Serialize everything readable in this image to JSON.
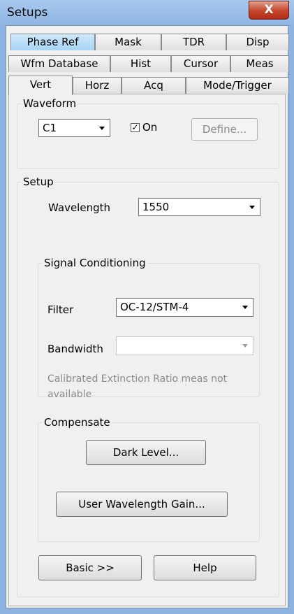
{
  "window": {
    "title": "Setups",
    "close_label": "X"
  },
  "tabs": {
    "row1": [
      "Phase Ref",
      "Mask",
      "TDR",
      "Disp"
    ],
    "row2": [
      "Wfm Database",
      "Hist",
      "Cursor",
      "Meas"
    ],
    "row3": [
      "Vert",
      "Horz",
      "Acq",
      "Mode/Trigger"
    ],
    "selected_row1": "Phase Ref",
    "active_tab": "Vert"
  },
  "waveform": {
    "legend": "Waveform",
    "channel_value": "C1",
    "on_checked": true,
    "on_label": "On",
    "define_label": "Define..."
  },
  "setup": {
    "legend": "Setup",
    "wavelength_label": "Wavelength",
    "wavelength_value": "1550",
    "signal_conditioning": {
      "legend": "Signal Conditioning",
      "filter_label": "Filter",
      "filter_value": "OC-12/STM-4",
      "bandwidth_label": "Bandwidth",
      "bandwidth_value": "",
      "note": "Calibrated Extinction Ratio meas not available"
    },
    "compensate": {
      "legend": "Compensate",
      "dark_level_label": "Dark Level...",
      "user_wavelength_gain_label": "User Wavelength Gain..."
    },
    "basic_label": "Basic >>",
    "help_label": "Help"
  },
  "icons": {
    "close": "close-icon",
    "dropdown": "chevron-down-icon",
    "check": "check-icon"
  }
}
